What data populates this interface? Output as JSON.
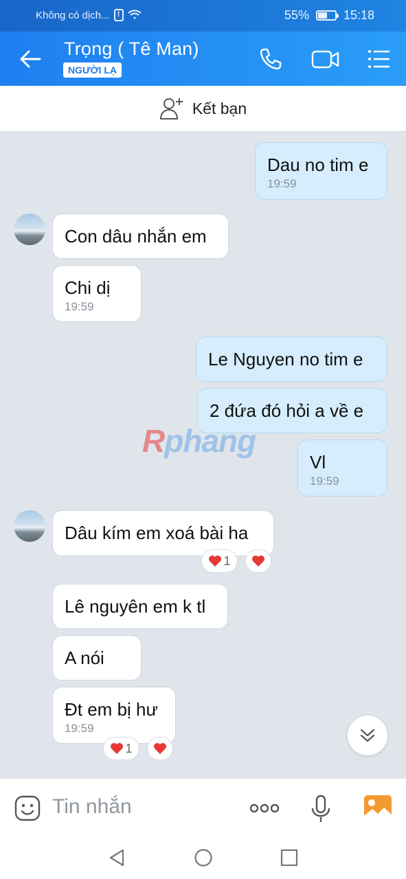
{
  "status": {
    "carrier": "Không có dịch...",
    "battery": "55%",
    "battery_level": 0.55,
    "time": "15:18"
  },
  "header": {
    "title": "Trọng ( Tê Man)",
    "badge": "NGƯỜI LẠ"
  },
  "friend_bar": {
    "label": "Kết bạn"
  },
  "messages": [
    {
      "dir": "out",
      "text": "Dau no tim e",
      "time": "19:59"
    },
    {
      "dir": "in",
      "text": "Con dâu nhắn em"
    },
    {
      "dir": "in",
      "text": "Chi dị",
      "time": "19:59"
    },
    {
      "dir": "out",
      "text": "Le Nguyen no tim e"
    },
    {
      "dir": "out",
      "text": "2 đứa đó hỏi a về e"
    },
    {
      "dir": "out",
      "text": "Vl",
      "time": "19:59"
    },
    {
      "dir": "in",
      "text": "Dâu kím em xoá bài ha",
      "reaction_count": "1"
    },
    {
      "dir": "in",
      "text": "Lê nguyên em k tl"
    },
    {
      "dir": "in",
      "text": "A nói"
    },
    {
      "dir": "in",
      "text": "Đt em bị hư",
      "time": "19:59",
      "reaction_count": "1"
    }
  ],
  "watermark": {
    "r": "R",
    "rest": "phang"
  },
  "input": {
    "placeholder": "Tin nhắn"
  },
  "colors": {
    "header": "#1e7ff0",
    "bubble_out": "#d5edfc",
    "bubble_in": "#ffffff",
    "background": "#dfe5eb"
  },
  "icons": [
    "back-arrow-icon",
    "phone-icon",
    "video-call-icon",
    "menu-list-icon",
    "add-user-icon",
    "heart-icon",
    "chevrons-down-icon",
    "sticker-icon",
    "more-dots-icon",
    "microphone-icon",
    "image-icon",
    "nav-back-icon",
    "nav-home-icon",
    "nav-recent-icon"
  ]
}
